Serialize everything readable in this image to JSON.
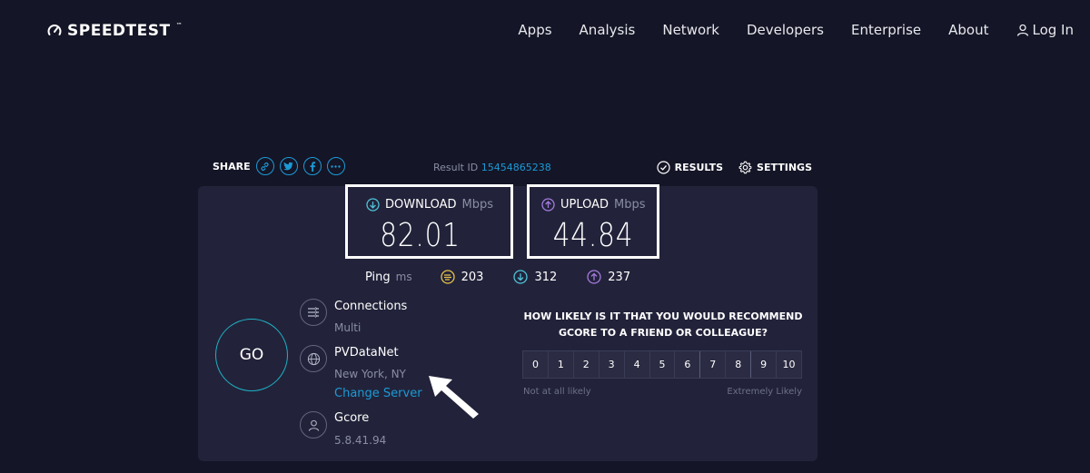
{
  "header": {
    "logo": "SPEEDTEST",
    "nav": [
      "Apps",
      "Analysis",
      "Network",
      "Developers",
      "Enterprise",
      "About"
    ],
    "login": "Log In"
  },
  "share": {
    "label": "SHARE",
    "buttons": [
      "link-icon",
      "twitter-icon",
      "facebook-icon",
      "more-icon"
    ]
  },
  "result": {
    "label": "Result ID",
    "id": "15454865238"
  },
  "actions": {
    "results": "RESULTS",
    "settings": "SETTINGS"
  },
  "download": {
    "label": "DOWNLOAD",
    "unit": "Mbps",
    "value": "82.01"
  },
  "upload": {
    "label": "UPLOAD",
    "unit": "Mbps",
    "value": "44.84"
  },
  "ping": {
    "label": "Ping",
    "unit": "ms",
    "idle": "203",
    "download": "312",
    "upload": "237"
  },
  "go": "GO",
  "connections": {
    "title": "Connections",
    "value": "Multi"
  },
  "host": {
    "title": "PVDataNet",
    "location": "New York, NY",
    "change": "Change Server"
  },
  "provider": {
    "title": "Gcore",
    "ip": "5.8.41.94"
  },
  "survey": {
    "question_line1": "HOW LIKELY IS IT THAT YOU WOULD RECOMMEND",
    "question_line2": "GCORE TO A FRIEND OR COLLEAGUE?",
    "scale": [
      "0",
      "1",
      "2",
      "3",
      "4",
      "5",
      "6",
      "7",
      "8",
      "9",
      "10"
    ],
    "low": "Not at all likely",
    "high": "Extremely Likely"
  },
  "colors": {
    "background": "#141526",
    "panel": "#22233a",
    "accent": "#1c9ad6",
    "download": "#4fc3d9",
    "upload": "#a57be0",
    "idle": "#e6c24a"
  }
}
